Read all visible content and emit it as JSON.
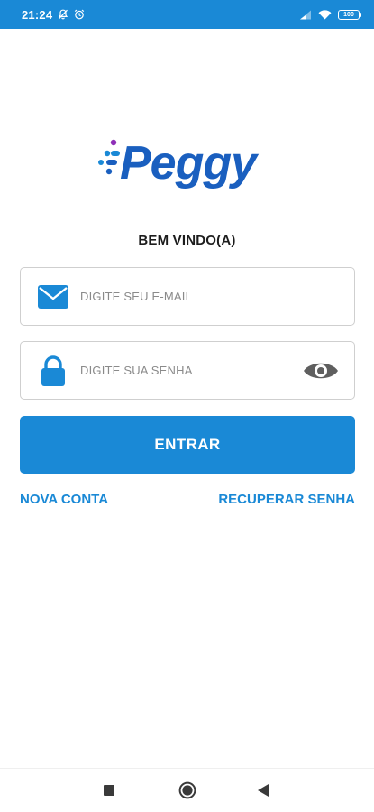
{
  "status_bar": {
    "time": "21:24",
    "battery": "100",
    "color": "#1a89d6"
  },
  "logo": {
    "text": "Peggy",
    "dot_colors": [
      "#1a89d6",
      "#8e2fb7"
    ],
    "color": "#1a5fbf"
  },
  "welcome": "BEM VINDO(A)",
  "email_field": {
    "placeholder": "DIGITE SEU E-MAIL",
    "value": "",
    "icon": "envelope-icon"
  },
  "password_field": {
    "placeholder": "DIGITE SUA SENHA",
    "value": "",
    "icon": "lock-icon",
    "toggle_icon": "eye-icon"
  },
  "login_button": "ENTRAR",
  "links": {
    "new_account": "NOVA CONTA",
    "recover_password": "RECUPERAR SENHA"
  },
  "nav": {
    "recents": "square-icon",
    "home": "circle-icon",
    "back": "triangle-back-icon"
  },
  "colors": {
    "accent": "#1a89d6",
    "text": "#1c1c1c",
    "border": "#cfcfcf",
    "placeholder": "#8a8a8a"
  }
}
